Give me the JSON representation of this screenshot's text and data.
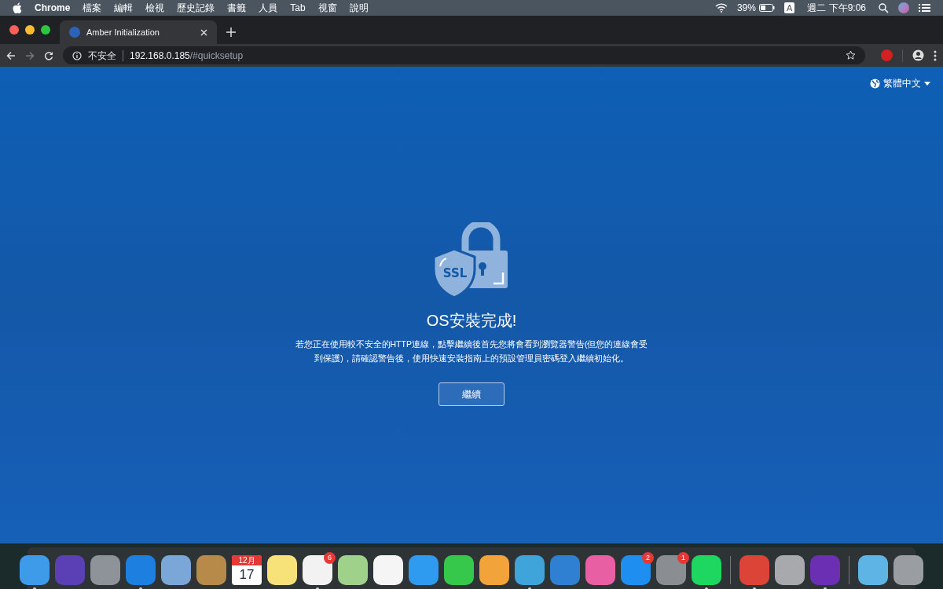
{
  "menu_bar": {
    "app_name": "Chrome",
    "menus": [
      "檔案",
      "編輯",
      "檢視",
      "歷史記錄",
      "書籤",
      "人員",
      "Tab",
      "視窗",
      "說明"
    ],
    "battery_percent": "39%",
    "input_source": "A",
    "clock": "週二 下午9:06"
  },
  "tabs": [
    {
      "title": "Amber Initialization",
      "selected": true
    }
  ],
  "address_bar": {
    "security_label": "不安全",
    "host": "192.168.0.185",
    "path": "/#quicksetup"
  },
  "page": {
    "language": "繁體中文",
    "icon_text": "SSL",
    "title": "OS安裝完成!",
    "message": "若您正在使用較不安全的HTTP連線，點擊繼續後首先您將會看到瀏覽器警告(但您的連線會受到保護)，請確認警告後，使用快速安裝指南上的預設管理員密碼登入繼續初始化。",
    "continue_button": "繼續"
  },
  "dock": [
    {
      "kind": "app",
      "color": "#3d9be9",
      "running": true
    },
    {
      "kind": "app",
      "color": "#5a3fb5",
      "running": false
    },
    {
      "kind": "app",
      "color": "#8e9399",
      "running": false
    },
    {
      "kind": "app",
      "color": "#1d7fe0",
      "running": true
    },
    {
      "kind": "app",
      "color": "#7aa7d8",
      "running": false
    },
    {
      "kind": "app",
      "color": "#b88a4a",
      "running": false
    },
    {
      "kind": "calendar",
      "month": "12月",
      "day": "17",
      "running": false
    },
    {
      "kind": "app",
      "color": "#f7e27a",
      "running": false
    },
    {
      "kind": "app",
      "color": "#f2f2f2",
      "running": true,
      "badge": "6"
    },
    {
      "kind": "app",
      "color": "#9fd18b",
      "running": false
    },
    {
      "kind": "app",
      "color": "#f5f5f5",
      "running": false
    },
    {
      "kind": "app",
      "color": "#2e9bf0",
      "running": false
    },
    {
      "kind": "app",
      "color": "#36c84a",
      "running": false
    },
    {
      "kind": "app",
      "color": "#f2a33a",
      "running": false
    },
    {
      "kind": "app",
      "color": "#3fa4d9",
      "running": true
    },
    {
      "kind": "app",
      "color": "#2f7fd3",
      "running": false
    },
    {
      "kind": "app",
      "color": "#e85fa3",
      "running": false
    },
    {
      "kind": "app",
      "color": "#1f8ef1",
      "running": false,
      "badge": "2"
    },
    {
      "kind": "app",
      "color": "#8a8d91",
      "running": false,
      "badge": "1"
    },
    {
      "kind": "app",
      "color": "#1ed760",
      "running": true
    },
    {
      "kind": "separator"
    },
    {
      "kind": "app",
      "color": "#db4437",
      "running": true
    },
    {
      "kind": "app",
      "color": "#a7a9ac",
      "running": false
    },
    {
      "kind": "app",
      "color": "#6b2fb3",
      "running": true
    },
    {
      "kind": "separator"
    },
    {
      "kind": "app",
      "color": "#5fb4e6",
      "running": false
    },
    {
      "kind": "app",
      "color": "#9a9ea3",
      "running": false
    }
  ]
}
